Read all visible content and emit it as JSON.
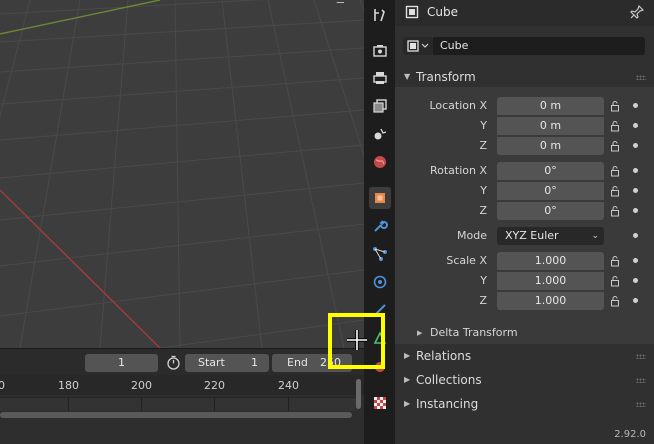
{
  "viewport": {
    "name": "3D Viewport"
  },
  "timeline": {
    "current_frame": "1",
    "start_label": "Start",
    "start_value": "1",
    "end_label": "End",
    "end_value": "250",
    "ruler_ticks": [
      "0",
      "180",
      "200",
      "220",
      "240"
    ]
  },
  "properties_tabs": [
    "tool-icon",
    "render-icon",
    "output-icon",
    "view-layer-icon",
    "scene-icon",
    "world-icon",
    "object-icon",
    "modifier-icon",
    "particles-icon",
    "physics-icon",
    "constraints-icon",
    "object-data-icon",
    "material-icon",
    "texture-icon"
  ],
  "properties": {
    "header_title": "Cube",
    "object_name": "Cube",
    "transform_section": "Transform",
    "location": {
      "label_x": "Location X",
      "label_y": "Y",
      "label_z": "Z",
      "x": "0 m",
      "y": "0 m",
      "z": "0 m"
    },
    "rotation": {
      "label_x": "Rotation X",
      "label_y": "Y",
      "label_z": "Z",
      "x": "0°",
      "y": "0°",
      "z": "0°"
    },
    "mode": {
      "label": "Mode",
      "value": "XYZ Euler"
    },
    "scale": {
      "label_x": "Scale X",
      "label_y": "Y",
      "label_z": "Z",
      "x": "1.000",
      "y": "1.000",
      "z": "1.000"
    },
    "delta_transform": "Delta Transform",
    "relations": "Relations",
    "collections": "Collections",
    "instancing": "Instancing"
  },
  "status": {
    "version": "2.92.0"
  },
  "colors": {
    "highlight": "#ffff00",
    "object_accent": "#e8864a",
    "modifier_accent": "#4f92d8"
  }
}
